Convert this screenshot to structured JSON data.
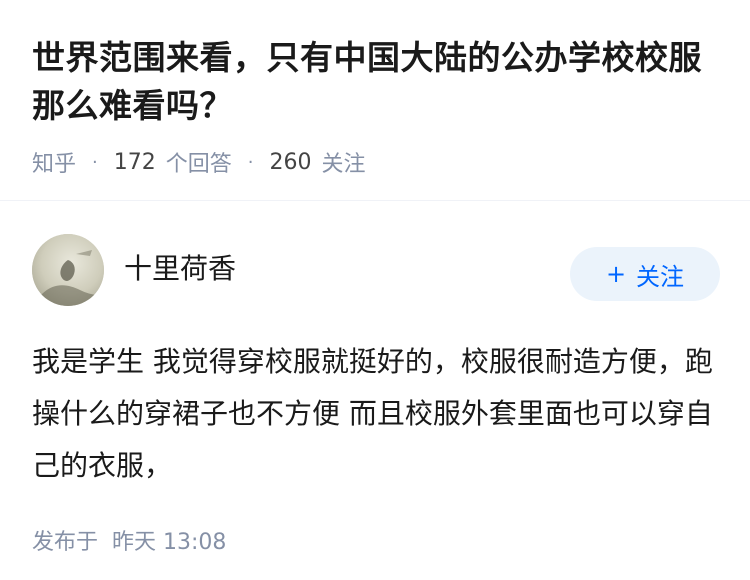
{
  "question": {
    "title": "世界范围来看，只有中国大陆的公办学校校服那么难看吗？",
    "source": "知乎",
    "answer_count": "172",
    "answer_label": "个回答",
    "follower_count": "260",
    "follower_label": "关注"
  },
  "answer": {
    "author_name": "十里荷香",
    "follow_button": {
      "plus": "+",
      "label": "关注"
    },
    "content": "我是学生 我觉得穿校服就挺好的，校服很耐造方便，跑操什么的穿裙子也不方便 而且校服外套里面也可以穿自己的衣服，",
    "published_label": "发布于",
    "published_time": "昨天 13:08"
  },
  "colors": {
    "accent": "#0066ff",
    "follow_bg": "#ebf3fb",
    "meta": "#8590a6"
  },
  "icons": {
    "avatar": "avatar-image"
  }
}
